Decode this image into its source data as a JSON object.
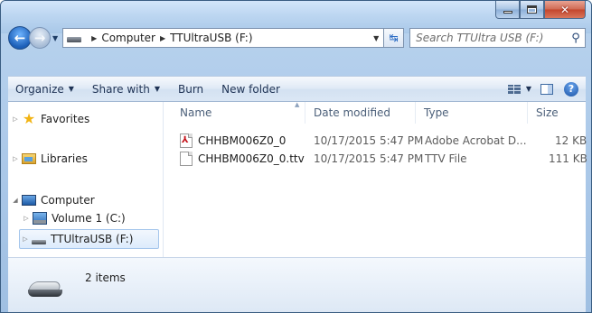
{
  "window": {
    "buttons": {
      "minimize": "",
      "maximize": "",
      "close": "✕"
    }
  },
  "address": {
    "crumbs": [
      "Computer",
      "TTUltraUSB (F:)"
    ]
  },
  "search": {
    "placeholder": "Search TTUltra USB (F:)"
  },
  "toolbar": {
    "organize": "Organize",
    "share_with": "Share with",
    "burn": "Burn",
    "new_folder": "New folder"
  },
  "nav": {
    "favorites": "Favorites",
    "libraries": "Libraries",
    "computer": "Computer",
    "volume1": "Volume 1 (C:)",
    "usb": "TTUltraUSB (F:)"
  },
  "columns": {
    "name": "Name",
    "date": "Date modified",
    "type": "Type",
    "size": "Size"
  },
  "files": [
    {
      "name": "CHHBM006Z0_0",
      "date": "10/17/2015 5:47 PM",
      "type": "Adobe Acrobat D...",
      "size": "12 KB",
      "icon": "pdf-file-icon"
    },
    {
      "name": "CHHBM006Z0_0.ttv",
      "date": "10/17/2015 5:47 PM",
      "type": "TTV File",
      "size": "111 KB",
      "icon": "generic-file-icon"
    }
  ],
  "status": {
    "items": "2 items"
  },
  "colors": {
    "selection": "#dcebfc",
    "accent": "#1c5fb8"
  }
}
